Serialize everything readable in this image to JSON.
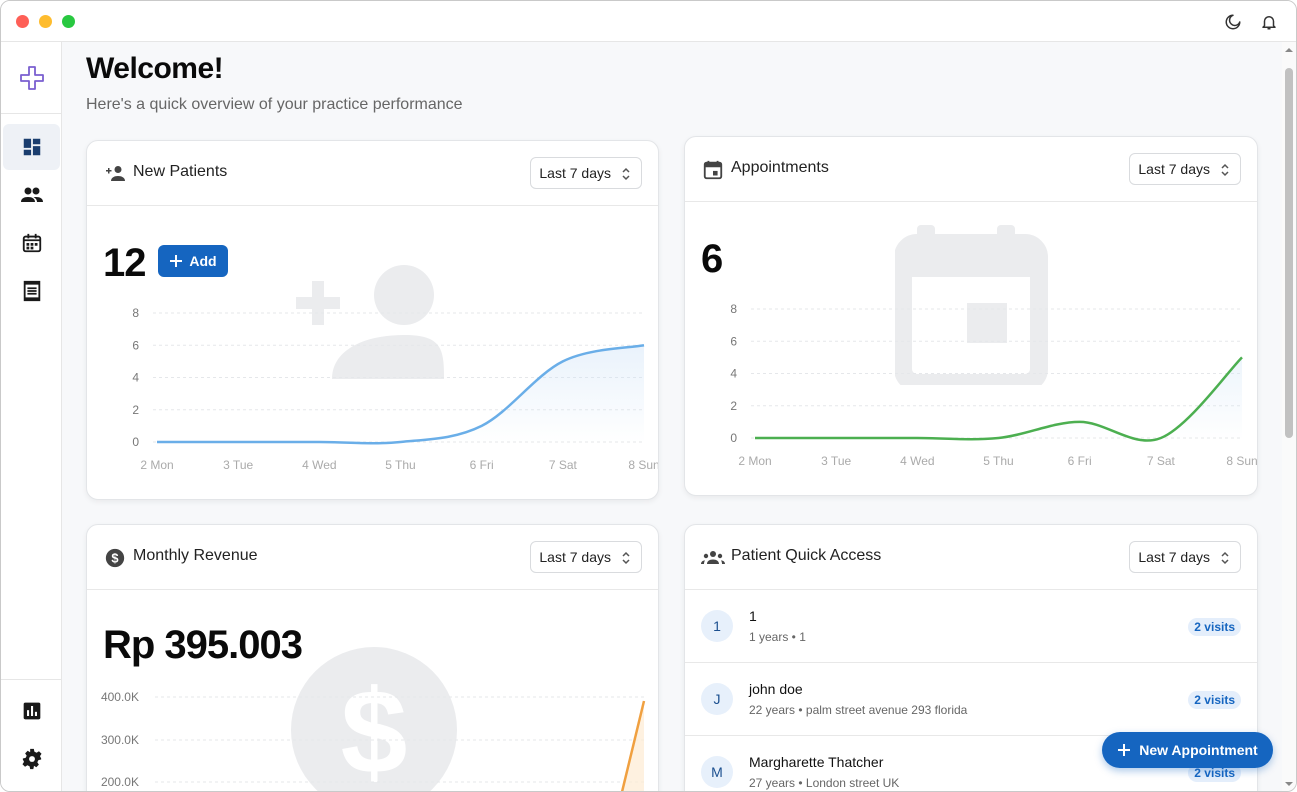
{
  "titlebar": {
    "icons": [
      "moon-icon",
      "bell-icon"
    ]
  },
  "sidebar": {
    "logo_icon": "plus-cross-icon",
    "items": [
      {
        "name": "dashboard",
        "icon": "dashboard-icon",
        "active": true
      },
      {
        "name": "patients",
        "icon": "people-icon",
        "active": false
      },
      {
        "name": "calendar",
        "icon": "calendar-icon",
        "active": false
      },
      {
        "name": "records",
        "icon": "receipt-icon",
        "active": false
      }
    ],
    "bottom_items": [
      {
        "name": "reports",
        "icon": "bar-chart-icon"
      },
      {
        "name": "settings",
        "icon": "gear-icon"
      }
    ]
  },
  "header": {
    "title": "Welcome!",
    "subtitle": "Here's a quick overview of your practice performance"
  },
  "new_patients": {
    "title": "New Patients",
    "range": "Last 7 days",
    "value": "12",
    "add_label": "Add"
  },
  "appointments": {
    "title": "Appointments",
    "range": "Last 7 days",
    "value": "6"
  },
  "revenue": {
    "title": "Monthly Revenue",
    "range": "Last 7 days",
    "value": "Rp 395.003",
    "y_ticks": [
      "400.0K",
      "300.0K",
      "200.0K"
    ]
  },
  "quick_access": {
    "title": "Patient Quick Access",
    "range": "Last 7 days",
    "patients": [
      {
        "initial": "1",
        "name": "1",
        "meta": "1 years • 1",
        "visits": "2 visits"
      },
      {
        "initial": "J",
        "name": "john doe",
        "meta": "22 years • palm street avenue 293 florida",
        "visits": "2 visits"
      },
      {
        "initial": "M",
        "name": "Margharette Thatcher",
        "meta": "27 years • London street UK",
        "visits": "2 visits"
      }
    ]
  },
  "fab": {
    "label": "New Appointment"
  },
  "colors": {
    "primary": "#1565c0",
    "patients_line": "#6aaee8",
    "appointments_line": "#4caf50",
    "revenue_line": "#f0a040"
  },
  "chart_data": [
    {
      "type": "area",
      "title": "New Patients",
      "categories": [
        "2 Mon",
        "3 Tue",
        "4 Wed",
        "5 Thu",
        "6 Fri",
        "7 Sat",
        "8 Sun"
      ],
      "values": [
        0,
        0,
        0,
        0,
        1,
        5,
        6
      ],
      "y_ticks": [
        "8",
        "6",
        "4",
        "2",
        "0"
      ],
      "ylim": [
        0,
        8
      ],
      "grid": true
    },
    {
      "type": "line",
      "title": "Appointments",
      "categories": [
        "2 Mon",
        "3 Tue",
        "4 Wed",
        "5 Thu",
        "6 Fri",
        "7 Sat",
        "8 Sun"
      ],
      "values": [
        0,
        0,
        0,
        0,
        1,
        0,
        5
      ],
      "y_ticks": [
        "8",
        "6",
        "4",
        "2",
        "0"
      ],
      "ylim": [
        0,
        8
      ],
      "grid": true
    }
  ]
}
